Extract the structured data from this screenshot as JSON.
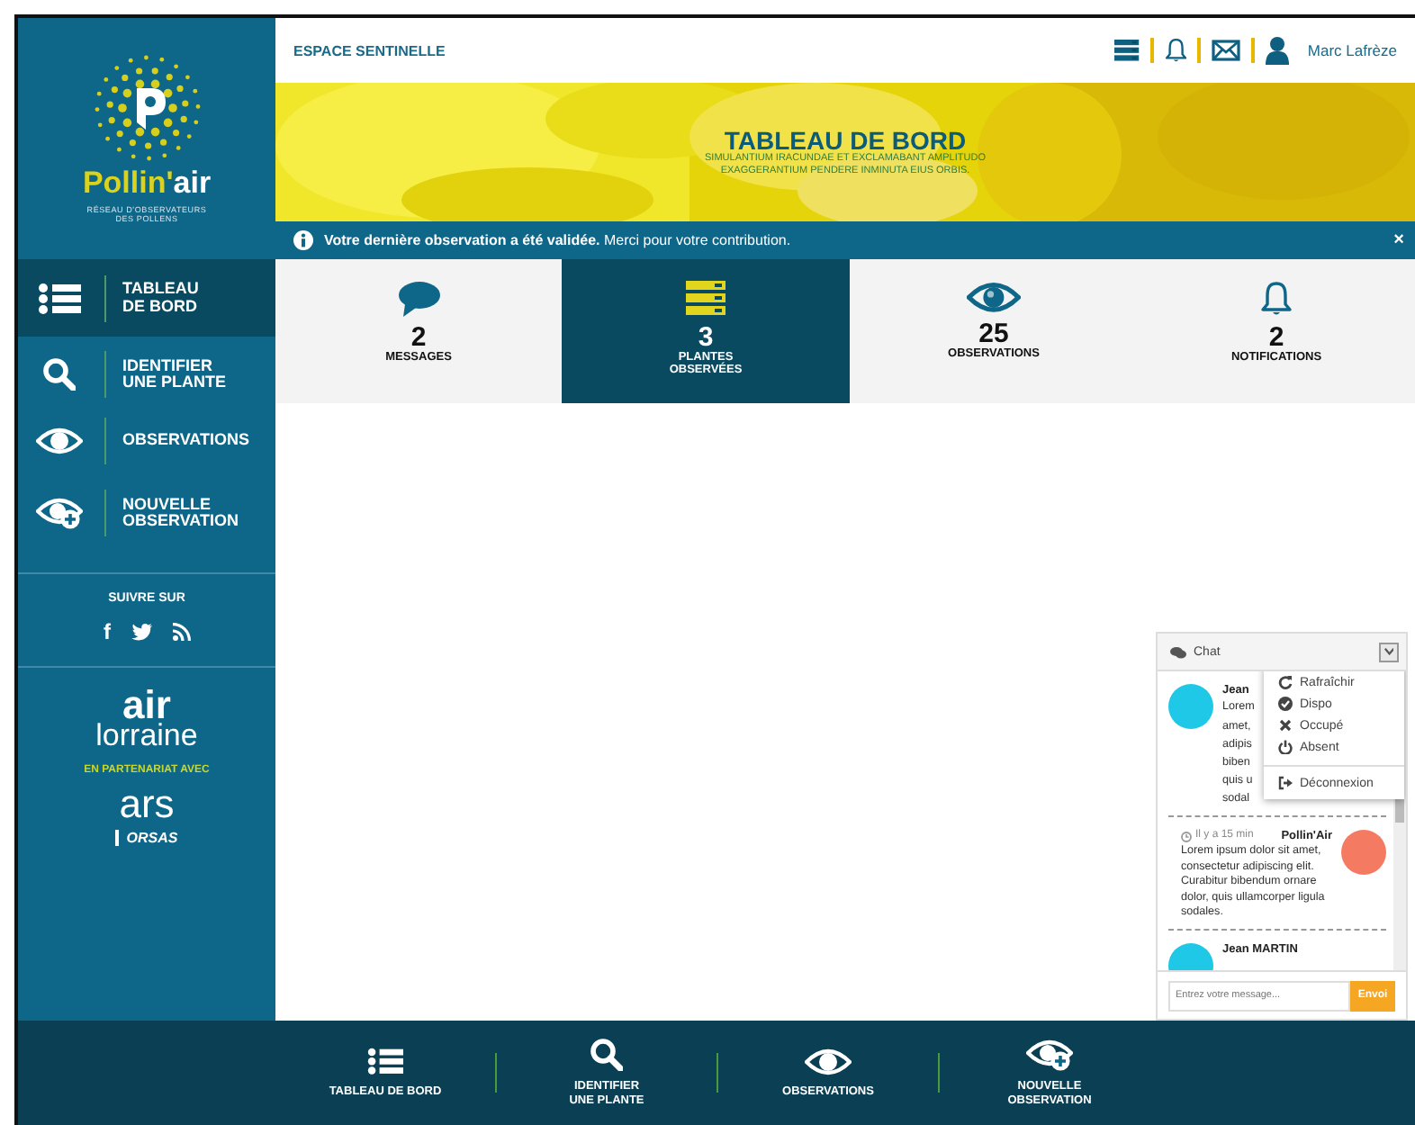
{
  "brand": {
    "name": [
      "Pollin'",
      "air"
    ],
    "tagline": "RÉSEAU D'OBSERVATEURS\nDES POLLENS"
  },
  "sidebar": {
    "items": [
      {
        "kind": "list",
        "label": "TABLEAU\nDE BORD",
        "selected": true
      },
      {
        "kind": "search",
        "label": "IDENTIFIER\nUNE PLANTE",
        "selected": false
      },
      {
        "kind": "eye",
        "label": "OBSERVATIONS",
        "selected": false
      },
      {
        "kind": "eyeplus",
        "label": "NOUVELLE\nOBSERVATION",
        "selected": false
      }
    ]
  },
  "follow": {
    "title": "SUIVRE SUR",
    "networks": [
      {
        "kind": "facebook",
        "glyph": "f"
      },
      {
        "kind": "twitter"
      },
      {
        "kind": "rss"
      }
    ]
  },
  "partners": {
    "logo_1": [
      "air",
      "lorraine"
    ],
    "caption": "EN PARTENARIAT AVEC",
    "logo_2": "ars",
    "logo_3": "ORSAS"
  },
  "header": {
    "title": "ESPACE SENTINELLE",
    "icons": [
      {
        "kind": "bars"
      },
      {
        "kind": "bell"
      },
      {
        "kind": "envelope"
      }
    ],
    "user": "Marc Lafrèze"
  },
  "banner": {
    "title": "TABLEAU DE BORD",
    "subtitle": "SIMULANTIUM IRACUNDAE ET EXCLAMABANT AMPLITUDO\nEXAGGERANTIUM PENDERE INMINUTA EIUS ORBIS."
  },
  "notice": {
    "text": "**Votre dernière observation a été validée.** Merci pour votre contribution.",
    "close": "×"
  },
  "stats": [
    {
      "kind": "chat",
      "count": "2",
      "label": "MESSAGES",
      "selected": false
    },
    {
      "kind": "bars",
      "count": "3",
      "label": "PLANTES\nOBSERVÉES",
      "selected": true
    },
    {
      "kind": "eye",
      "count": "25",
      "label": "OBSERVATIONS",
      "selected": false
    },
    {
      "kind": "bell",
      "count": "2",
      "label": "NOTIFICATIONS",
      "selected": false
    }
  ],
  "chat": {
    "title": "Chat",
    "messages": [
      {
        "kind": "incoming",
        "color": "#1ec8e6",
        "author": "Jean",
        "lines": [
          "Lorem",
          "amet,",
          "adipis",
          "biben",
          "quis u",
          "sodal"
        ]
      },
      {
        "kind": "outgoing",
        "color": "#f57a62",
        "time": "Il y a 15 min",
        "author": "Pollin'Air",
        "text": "Lorem ipsum dolor sit amet, consectetur adipiscing elit. Curabitur bibendum ornare dolor, quis ullamcorper ligula sodales."
      },
      {
        "kind": "incoming",
        "color": "#1ec8e6",
        "author": "Jean MARTIN"
      }
    ],
    "menu": [
      {
        "kind": "refresh",
        "label": "Rafraîchir"
      },
      {
        "kind": "check",
        "label": "Dispo"
      },
      {
        "kind": "cross",
        "label": "Occupé"
      },
      {
        "kind": "power",
        "label": "Absent"
      },
      {
        "kind": "exit",
        "label": "Déconnexion"
      }
    ],
    "input": {
      "placeholder": "Entrez votre message..."
    },
    "send": "Envoi"
  },
  "bottom_nav": [
    {
      "kind": "list",
      "label": "TABLEAU DE BORD"
    },
    {
      "kind": "search",
      "label": "IDENTIFIER\nUNE PLANTE"
    },
    {
      "kind": "eye",
      "label": "OBSERVATIONS"
    },
    {
      "kind": "eyeplus",
      "label": "NOUVELLE\nOBSERVATION"
    }
  ]
}
